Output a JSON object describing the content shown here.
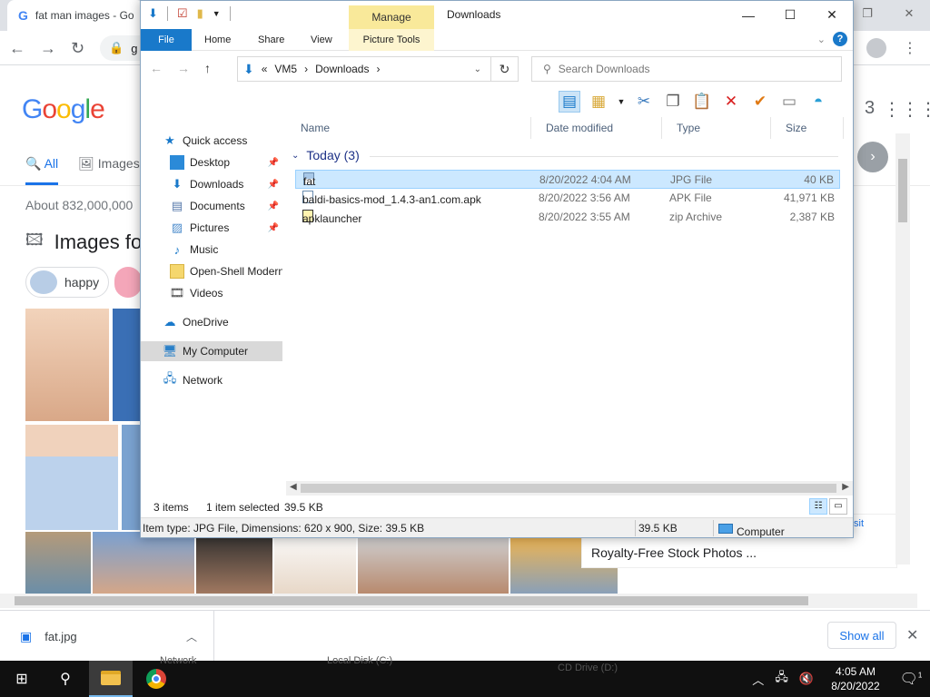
{
  "chrome": {
    "tab_title": "fat man images - Go",
    "omnibox_text": "g",
    "profile_number": "3"
  },
  "google": {
    "logo_text": "Google",
    "tab_all": "All",
    "tab_images": "Images",
    "about": "About 832,000,000",
    "images_section": "Images fo",
    "chip_label": "happy",
    "side_card_title": "Royalty-Free Stock Photos ...",
    "side_card_visit": "sit"
  },
  "downloads": {
    "file": "fat.jpg",
    "show_all": "Show all"
  },
  "taskbar": {
    "time": "4:05 AM",
    "date": "8/20/2022",
    "notification_count": "1",
    "ghost_text_1": "Network",
    "ghost_text_2": "Local Disk (C:)",
    "ghost_text_3": "CD Drive (D:)"
  },
  "explorer": {
    "title": "Downloads",
    "manage_tab": "Manage",
    "ribbon_tabs": {
      "file": "File",
      "home": "Home",
      "share": "Share",
      "view": "View",
      "picture_tools": "Picture Tools"
    },
    "address": {
      "prefix": "«",
      "crumb1": "VM5",
      "crumb2": "Downloads"
    },
    "search_placeholder": "Search Downloads",
    "nav": {
      "quick_access": "Quick access",
      "desktop": "Desktop",
      "downloads": "Downloads",
      "documents": "Documents",
      "pictures": "Pictures",
      "music": "Music",
      "openshell": "Open-Shell Modern",
      "videos": "Videos",
      "onedrive": "OneDrive",
      "my_computer": "My Computer",
      "network": "Network"
    },
    "columns": {
      "name": "Name",
      "date_modified": "Date modified",
      "type": "Type",
      "size": "Size"
    },
    "group": "Today (3)",
    "files": [
      {
        "name": "fat",
        "date": "8/20/2022 4:04 AM",
        "type": "JPG File",
        "size": "40 KB"
      },
      {
        "name": "baldi-basics-mod_1.4.3-an1.com.apk",
        "date": "8/20/2022 3:56 AM",
        "type": "APK File",
        "size": "41,971 KB"
      },
      {
        "name": "apklauncher",
        "date": "8/20/2022 3:55 AM",
        "type": "zip Archive",
        "size": "2,387 KB"
      }
    ],
    "status": {
      "item_count": "3 items",
      "selected": "1 item selected",
      "selected_size": "39.5 KB",
      "details": "Item type: JPG File, Dimensions: 620 x 900, Size: 39.5 KB",
      "size2": "39.5 KB",
      "location": "Computer"
    }
  }
}
